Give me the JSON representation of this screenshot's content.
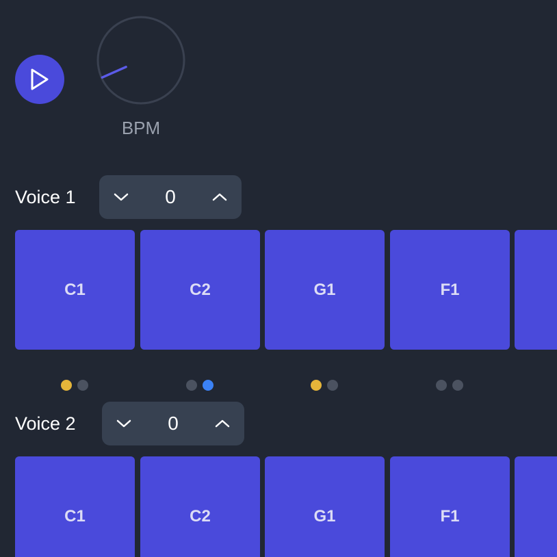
{
  "transport": {
    "play_icon": "play-icon"
  },
  "tempo": {
    "label": "BPM",
    "knob_level": 0.12
  },
  "voices": [
    {
      "label": "Voice 1",
      "value": "0",
      "decrement_icon": "chevron-down-icon",
      "increment_icon": "chevron-up-icon",
      "pads": [
        "C1",
        "C2",
        "G1",
        "F1",
        ""
      ]
    },
    {
      "label": "Voice 2",
      "value": "0",
      "decrement_icon": "chevron-down-icon",
      "increment_icon": "chevron-up-icon",
      "pads": [
        "C1",
        "C2",
        "G1",
        "F1",
        ""
      ]
    }
  ],
  "step_indicators": [
    [
      "active-yellow",
      "inactive"
    ],
    [
      "inactive",
      "active-blue"
    ],
    [
      "active-yellow",
      "inactive"
    ],
    [
      "inactive",
      "inactive"
    ]
  ],
  "colors": {
    "background": "#212733",
    "accent": "#4a4adb",
    "stepper_bg": "#374151",
    "dot_inactive": "#4b5260",
    "dot_yellow": "#e5b53a",
    "dot_blue": "#3b82f6",
    "knob_ring": "#3a4150",
    "knob_indicator": "#5b5be8"
  }
}
